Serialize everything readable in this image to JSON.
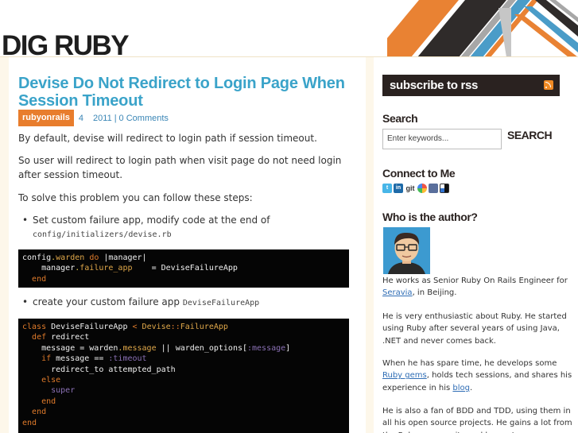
{
  "site": {
    "logo": "DIG RUBY",
    "stripe_colors": [
      "#e98233",
      "#2f2b2a",
      "#4a9cc8",
      "#a7a7a7"
    ]
  },
  "post": {
    "title": "Devise Do Not Redirect to Login Page When Session Timeout",
    "tag": "rubyonrails",
    "date_day": "4",
    "date_year": "2011",
    "separator": "|",
    "comments": "0 Comments",
    "paragraphs": [
      "By default, devise will redirect to login path if session timeout.",
      "So user will redirect to login path when visit page do not need login after session timeout.",
      "To solve this problem you can follow these steps:"
    ],
    "bullets": [
      {
        "text": "Set custom failure app, modify code at the end of",
        "code": "config/initializers/devise.rb"
      },
      {
        "text": "create your custom failure app",
        "code": "DeviseFailureApp"
      }
    ]
  },
  "sidebar": {
    "rss_label": "subscribe to rss",
    "search_heading": "Search",
    "search_placeholder": "Enter keywords...",
    "search_button": "SEARCH",
    "connect_heading": "Connect to Me",
    "social_icons": [
      "twitter-icon",
      "linkedin-icon",
      "git-icon",
      "google-plus-icon",
      "bookmark-icon",
      "delicious-icon"
    ],
    "git_label": "git",
    "author_heading": "Who is the author?",
    "bio": {
      "p1_before": "He works as Senior Ruby On Rails Engineer for",
      "p1_link": "Seravia",
      "p1_after": ", in Beijing.",
      "p2": "He is very enthusiastic about Ruby. He started using Ruby after several years of using Java, .NET and never comes back.",
      "p3_before": "When he has spare time, he develops some",
      "p3_link1": "Ruby gems",
      "p3_middle": ", holds tech sessions, and shares his experience in his",
      "p3_link2": "blog",
      "p3_after": ".",
      "p4": "He is also a fan of BDD and TDD, using them in all his open source projects. He gains a lot from the Ruby community and hopes to"
    }
  }
}
